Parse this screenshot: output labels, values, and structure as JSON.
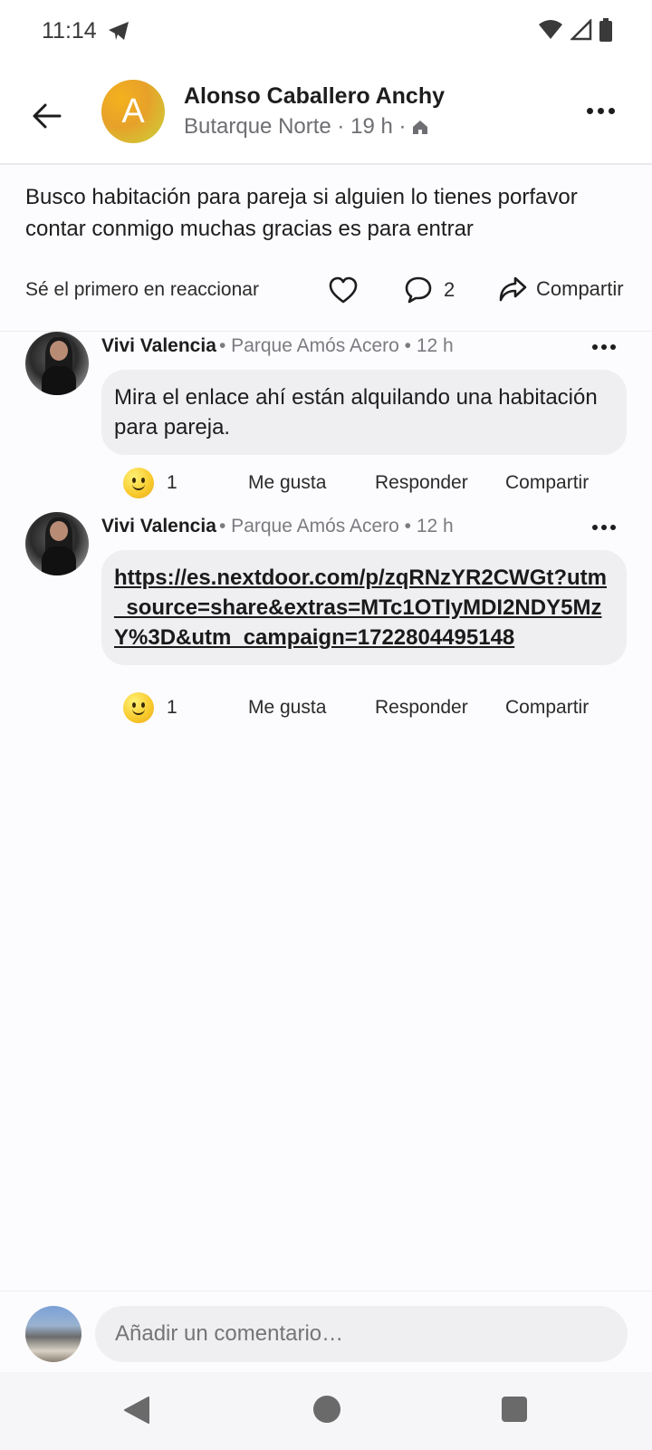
{
  "status": {
    "time": "11:14"
  },
  "header": {
    "avatar_letter": "A",
    "author": "Alonso Caballero Anchy",
    "meta": "Butarque Norte · 19 h ·"
  },
  "post": {
    "text": "Busco habitación para pareja si alguien lo tienes porfavor contar conmigo muchas gracias es para entrar",
    "react_prompt": "Sé el primero en reaccionar",
    "comment_count": "2",
    "share_label": "Compartir"
  },
  "comments": [
    {
      "name": "Vivi Valencia",
      "meta": "• Parque Amós Acero  •  12 h",
      "text": "Mira el enlace ahí están alquilando una habitación para pareja.",
      "reaction_count": "1",
      "like_label": "Me gusta",
      "reply_label": "Responder",
      "share_label": "Compartir"
    },
    {
      "name": "Vivi Valencia",
      "meta": "• Parque Amós Acero  •  12 h",
      "link": "https://es.nextdoor.com/p/zqRNzYR2CWGt?utm_source=share&extras=MTc1OTIyMDI2NDY5MzY%3D&utm_campaign=1722804495148",
      "reaction_count": "1",
      "like_label": "Me gusta",
      "reply_label": "Responder",
      "share_label": "Compartir"
    }
  ],
  "composer": {
    "placeholder": "Añadir un comentario…"
  }
}
